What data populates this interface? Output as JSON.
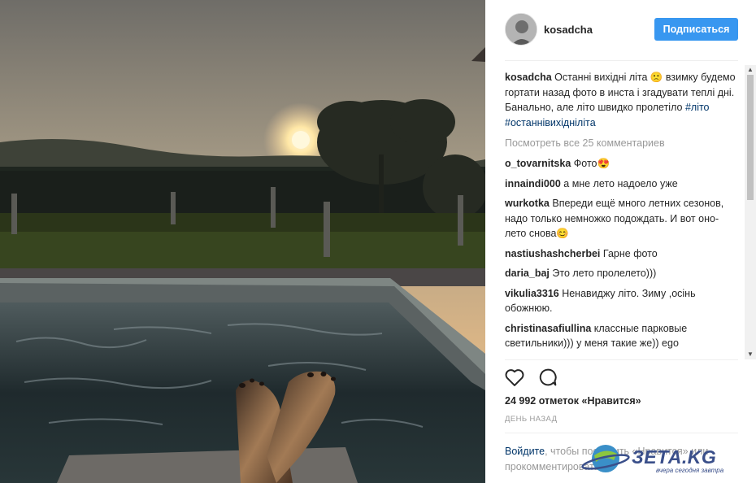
{
  "post": {
    "username": "kosadcha",
    "follow_label": "Подписаться",
    "caption": {
      "author": "kosadcha",
      "text": "Останні вихідні літа 🙁 взимку будемо гортати назад фото в инста і згадувати теплі дні. Банально, але літо швидко пролетіло",
      "tag1": "#літо",
      "tag2": "#останнівихіднілітa"
    },
    "view_all": "Посмотреть все 25 комментариев",
    "comments": [
      {
        "author": "o_tovarnitska",
        "text": "Фото😍"
      },
      {
        "author": "innaindi000",
        "text": "а мне лето надоело уже"
      },
      {
        "author": "wurkotka",
        "text": "Впереди ещё много летних сезонов, надо только немножко подождать. И вот оно- лето снова😊"
      },
      {
        "author": "nastiushashcherbei",
        "text": "Гарне фото"
      },
      {
        "author": "daria_baj",
        "text": "Это лето пролелето)))"
      },
      {
        "author": "vikulia3316",
        "text": "Ненавиджу літо. Зиму ,осінь обожнюю."
      },
      {
        "author": "christinasafiullina",
        "text": "классные парковые светильники))) у меня такие же)) ego"
      }
    ],
    "likes": "24 992 отметок «Нравится»",
    "time": "ДЕНЬ НАЗАД",
    "login_link": "Войдите",
    "login_text": ", чтобы поставить «Нравится» или прокомментировать.",
    "watermark": "ЗЕТА.KG",
    "watermark_sub": "вчера сегодня завтра"
  },
  "icons": [
    "heart-icon",
    "comment-icon",
    "scroll-up-icon",
    "scroll-down-icon"
  ]
}
